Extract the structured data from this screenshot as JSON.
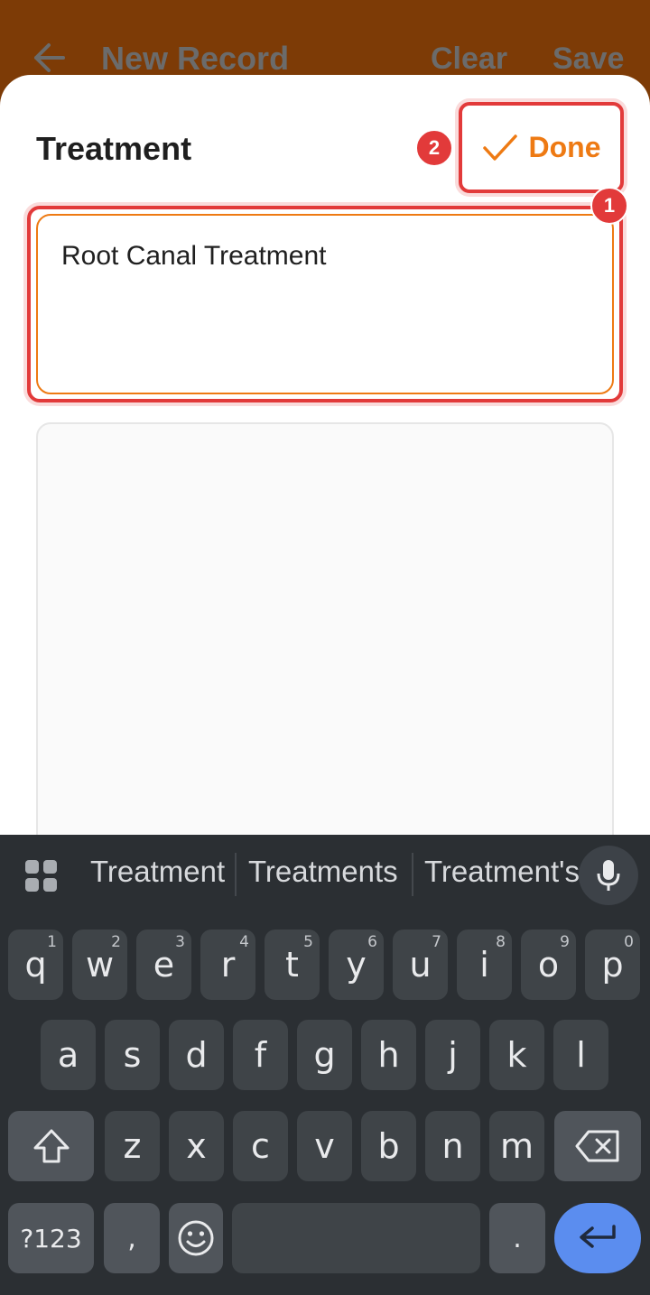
{
  "appbar": {
    "title": "New Record",
    "clear_label": "Clear",
    "save_label": "Save",
    "back_icon": "arrow-left-icon"
  },
  "sheet": {
    "title": "Treatment",
    "done_label": "Done",
    "field_value": "Root Canal Treatment",
    "notes_value": ""
  },
  "annotations": {
    "badge_1": "1",
    "badge_2": "2"
  },
  "keyboard": {
    "suggestions": [
      "Treatment",
      "Treatments",
      "Treatment's"
    ],
    "row1": [
      {
        "k": "q",
        "h": "1"
      },
      {
        "k": "w",
        "h": "2"
      },
      {
        "k": "e",
        "h": "3"
      },
      {
        "k": "r",
        "h": "4"
      },
      {
        "k": "t",
        "h": "5"
      },
      {
        "k": "y",
        "h": "6"
      },
      {
        "k": "u",
        "h": "7"
      },
      {
        "k": "i",
        "h": "8"
      },
      {
        "k": "o",
        "h": "9"
      },
      {
        "k": "p",
        "h": "0"
      }
    ],
    "row2": [
      "a",
      "s",
      "d",
      "f",
      "g",
      "h",
      "j",
      "k",
      "l"
    ],
    "row3": [
      "z",
      "x",
      "c",
      "v",
      "b",
      "n",
      "m"
    ],
    "symbols_label": "?123",
    "comma_label": ",",
    "period_label": "."
  },
  "colors": {
    "accent": "#ee7a13",
    "highlight": "#e23a3a",
    "appbar": "#7d3b06",
    "keyboard_bg": "#2b2f33",
    "key_bg": "#3f4448",
    "enter_key": "#5b8def"
  }
}
